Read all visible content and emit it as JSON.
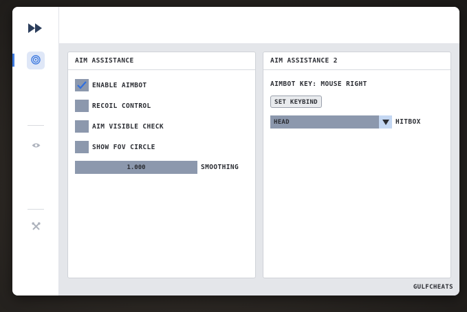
{
  "sidebar": {
    "items": [
      {
        "icon": "fast-forward-icon",
        "role": "logo"
      },
      {
        "icon": "target-icon",
        "active": true
      },
      {
        "icon": "eye-icon",
        "active": false
      },
      {
        "icon": "tools-icon",
        "active": false
      }
    ]
  },
  "panel_aim": {
    "title": "AIM ASSISTANCE",
    "enable_aimbot": {
      "label": "ENABLE AIMBOT",
      "checked": true
    },
    "recoil_control": {
      "label": "RECOIL CONTROL",
      "checked": false
    },
    "aim_visible_check": {
      "label": "AIM VISIBLE CHECK",
      "checked": false
    },
    "show_fov_circle": {
      "label": "SHOW FOV CIRCLE",
      "checked": false
    },
    "smoothing": {
      "label": "SMOOTHING",
      "value": "1.000"
    }
  },
  "panel_aim2": {
    "title": "AIM ASSISTANCE 2",
    "aimbot_key": "AIMBOT KEY: MOUSE RIGHT",
    "set_keybind": "SET KEYBIND",
    "hitbox": {
      "label": "HITBOX",
      "selected": "HEAD"
    }
  },
  "footer": {
    "brand": "GULFCHEATS"
  },
  "colors": {
    "accent": "#3f7be0",
    "control": "#8c98ad",
    "dropdown_arrow_bg": "#c4d7f2",
    "content_bg": "#e4e6ea"
  }
}
